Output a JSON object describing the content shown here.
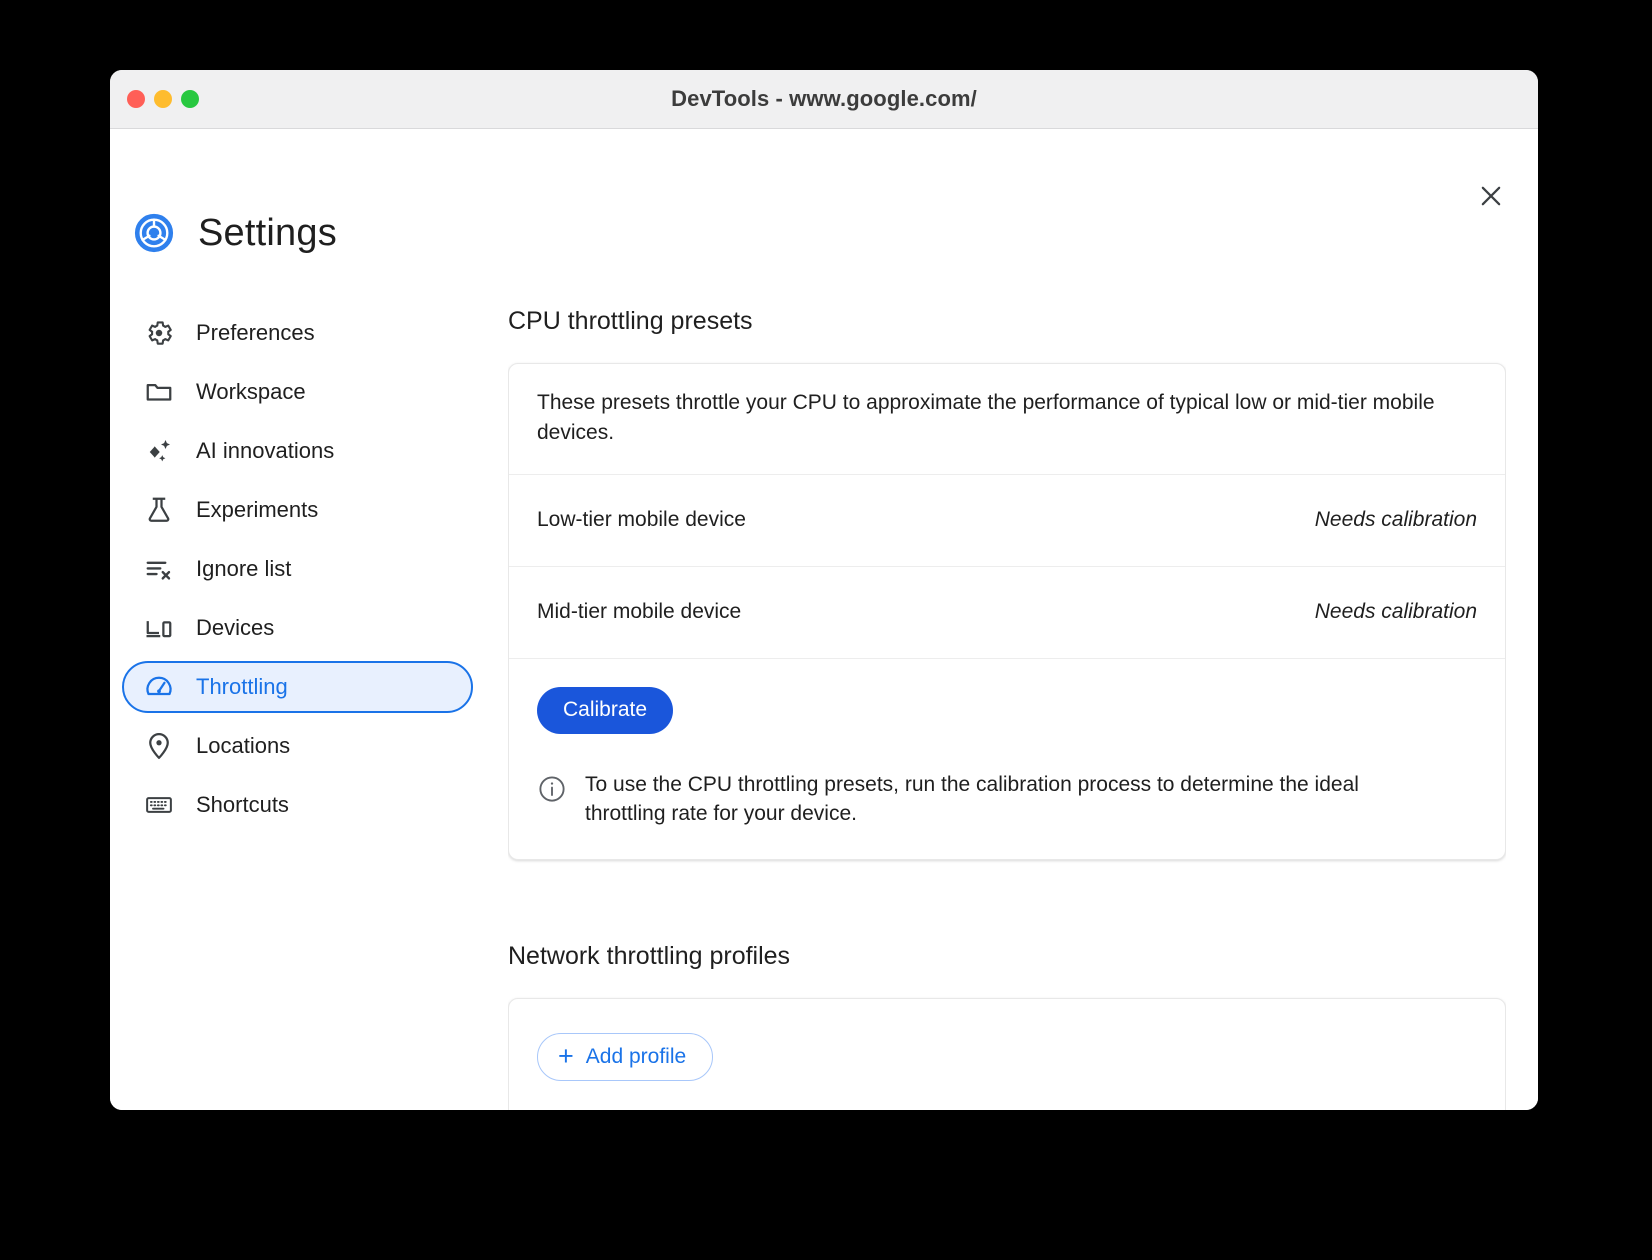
{
  "window": {
    "title": "DevTools - www.google.com/",
    "traffic_lights": [
      "close",
      "minimize",
      "maximize"
    ],
    "colors": {
      "close": "#ff5f57",
      "minimize": "#febc2e",
      "maximize": "#28c840",
      "titlebar_bg": "#f0f0f1"
    }
  },
  "dialog": {
    "title": "Settings",
    "logo_icon": "chrome-logo-icon",
    "close_icon": "close-icon",
    "accent_color": "#1a73e8"
  },
  "sidebar": {
    "items": [
      {
        "label": "Preferences",
        "icon": "gear-icon",
        "selected": false
      },
      {
        "label": "Workspace",
        "icon": "folder-icon",
        "selected": false
      },
      {
        "label": "AI innovations",
        "icon": "sparkle-icon",
        "selected": false
      },
      {
        "label": "Experiments",
        "icon": "flask-icon",
        "selected": false
      },
      {
        "label": "Ignore list",
        "icon": "list-x-icon",
        "selected": false
      },
      {
        "label": "Devices",
        "icon": "devices-icon",
        "selected": false
      },
      {
        "label": "Throttling",
        "icon": "speedometer-icon",
        "selected": true
      },
      {
        "label": "Locations",
        "icon": "location-pin-icon",
        "selected": false
      },
      {
        "label": "Shortcuts",
        "icon": "keyboard-icon",
        "selected": false
      }
    ]
  },
  "cpu_section": {
    "title": "CPU throttling presets",
    "description": "These presets throttle your CPU to approximate the performance of typical low or mid-tier mobile devices.",
    "presets": [
      {
        "name": "Low-tier mobile device",
        "status": "Needs calibration"
      },
      {
        "name": "Mid-tier mobile device",
        "status": "Needs calibration"
      }
    ],
    "calibrate_label": "Calibrate",
    "info_icon": "info-icon",
    "info_text": "To use the CPU throttling presets, run the calibration process to determine the ideal throttling rate for your device."
  },
  "network_section": {
    "title": "Network throttling profiles",
    "add_profile_label": "Add profile",
    "add_profile_icon": "plus-icon"
  }
}
